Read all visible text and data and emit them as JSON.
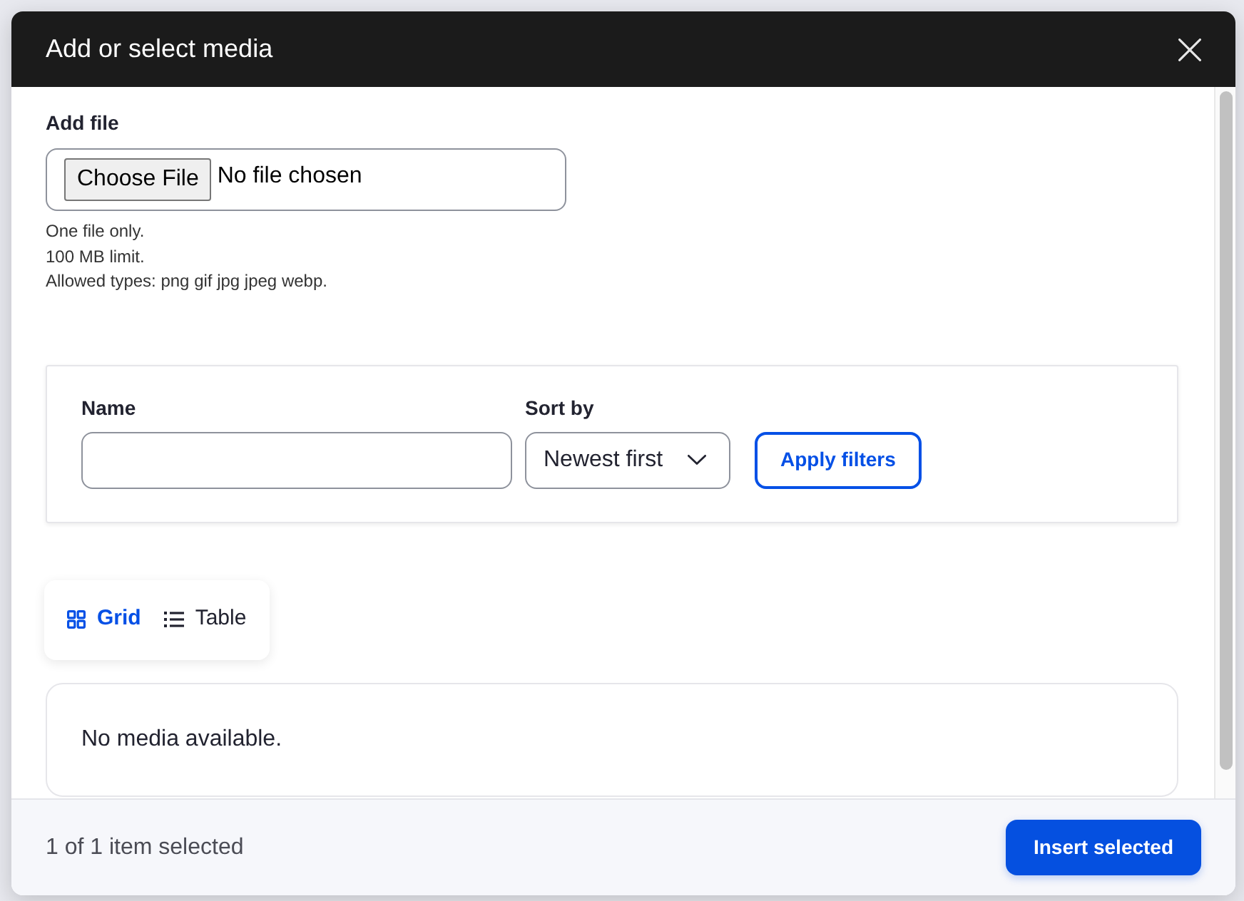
{
  "dialog": {
    "title": "Add or select media"
  },
  "add_file": {
    "label": "Add file",
    "button": "Choose File",
    "status": "No file chosen",
    "descriptions": [
      "One file only.",
      "100 MB limit.",
      "Allowed types: png gif jpg jpeg webp."
    ]
  },
  "filters": {
    "fields": [
      {
        "kind": "text",
        "label": "Name"
      },
      {
        "kind": "select",
        "label": "Sort by",
        "value": "Newest first"
      }
    ],
    "button": "Apply filters"
  },
  "view_tabs": [
    {
      "kind": "grid",
      "label": "Grid",
      "selected": true
    },
    {
      "kind": "table",
      "label": "Table",
      "selected": false
    }
  ],
  "empty_message": "No media available.",
  "footer": {
    "status": "1 of 1 item selected",
    "button": "Insert selected"
  }
}
